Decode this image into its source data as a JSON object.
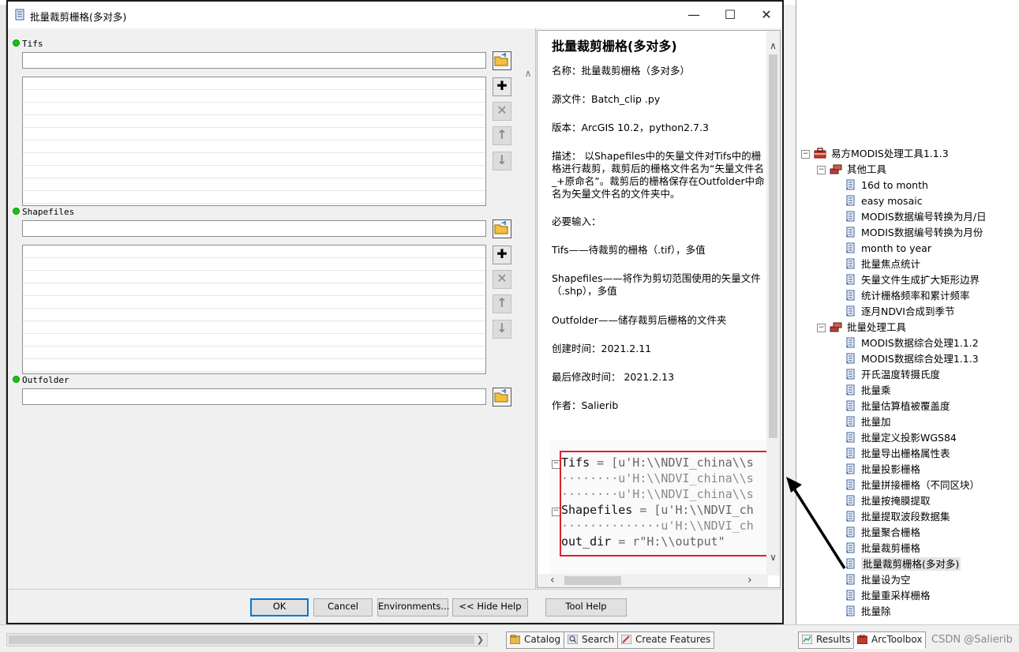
{
  "dialog": {
    "title": "批量裁剪栅格(多对多)",
    "params": [
      {
        "label": "Tifs"
      },
      {
        "label": "Shapefiles"
      },
      {
        "label": "Outfolder"
      }
    ],
    "buttons": {
      "ok": "OK",
      "cancel": "Cancel",
      "environments": "Environments...",
      "hide_help": "<< Hide Help",
      "tool_help": "Tool Help"
    }
  },
  "help": {
    "title": "批量裁剪栅格(多对多)",
    "name": "名称：批量裁剪栅格（多对多）",
    "source": "源文件：Batch_clip .py",
    "version": "版本：ArcGIS 10.2，python2.7.3",
    "description": "描述： 以Shapefiles中的矢量文件对Tifs中的栅格进行裁剪，裁剪后的栅格文件名为“矢量文件名_+原命名”。裁剪后的栅格保存在Outfolder中命名为矢量文件名的文件夹中。",
    "required": "必要输入：",
    "tifs": "Tifs——待裁剪的栅格（.tif），多值",
    "shapefiles": "Shapefiles——将作为剪切范围使用的矢量文件（.shp），多值",
    "outfolder": "Outfolder——储存裁剪后栅格的文件夹",
    "created": "创建时间：2021.2.11",
    "modified": "最后修改时间： 2021.2.13",
    "author": "作者：Salierib",
    "code": {
      "l1a": "Tifs",
      "l1b": " = [u'H:\\\\NDVI_china\\\\s",
      "l2": "········u'H:\\\\NDVI_china\\\\s",
      "l3": "········u'H:\\\\NDVI_china\\\\s",
      "l4a": "Shapefiles",
      "l4b": " = [u'H:\\\\NDVI_ch",
      "l5": "··············u'H:\\\\NDVI_ch",
      "l6a": "out_dir",
      "l6b": " = r\"H:\\\\output\""
    }
  },
  "tree": {
    "root": "易方MODIS处理工具1.1.3",
    "groups": [
      {
        "label": "其他工具",
        "items": [
          "16d to month",
          "easy mosaic",
          "MODIS数据编号转换为月/日",
          "MODIS数据编号转换为月份",
          "month to year",
          "批量焦点统计",
          "矢量文件生成扩大矩形边界",
          "统计栅格频率和累计频率",
          "逐月NDVI合成到季节"
        ]
      },
      {
        "label": "批量处理工具",
        "items": [
          "MODIS数据综合处理1.1.2",
          "MODIS数据综合处理1.1.3",
          "开氏温度转摄氏度",
          "批量乘",
          "批量估算植被覆盖度",
          "批量加",
          "批量定义投影WGS84",
          "批量导出栅格属性表",
          "批量投影栅格",
          "批量拼接栅格（不同区块）",
          "批量按掩膜提取",
          "批量提取波段数据集",
          "批量聚合栅格",
          "批量裁剪栅格",
          "批量裁剪栅格(多对多)",
          "批量设为空",
          "批量重采样栅格",
          "批量除"
        ]
      }
    ],
    "selected": "批量裁剪栅格(多对多)"
  },
  "bottom_tabs": {
    "catalog": "Catalog",
    "search": "Search",
    "create_features": "Create Features",
    "results": "Results",
    "arctoolbox": "ArcToolbox"
  },
  "watermark": "CSDN @Salierib",
  "colors": {
    "red_box": "#d9232e",
    "required_dot": "#16c60c",
    "default_button": "#0078d7"
  }
}
